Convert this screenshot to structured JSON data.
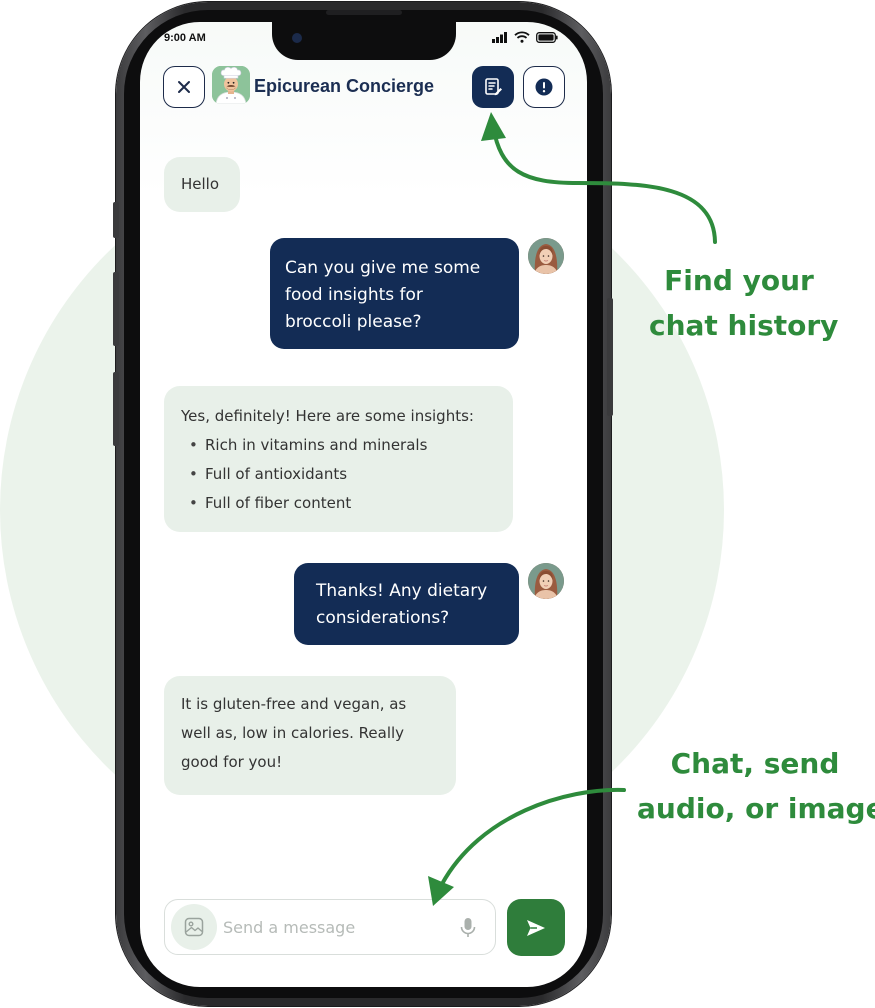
{
  "status_bar": {
    "time": "9:00 AM"
  },
  "header": {
    "title": "Epicurean Concierge",
    "close_icon": "close-icon",
    "history_icon": "chat-history-icon",
    "info_icon": "info-icon"
  },
  "messages": [
    {
      "sender": "bot",
      "text": "Hello"
    },
    {
      "sender": "user",
      "lines": [
        "Can you give me some",
        "food insights for",
        "broccoli please?"
      ]
    },
    {
      "sender": "bot",
      "intro": "Yes, definitely! Here are some insights:",
      "items": [
        "Rich in vitamins and minerals",
        "Full of antioxidants",
        "Full of fiber content"
      ]
    },
    {
      "sender": "user",
      "lines": [
        "Thanks! Any dietary",
        "considerations?"
      ]
    },
    {
      "sender": "bot",
      "lines": [
        "It is gluten-free and vegan, as",
        "well as, low in calories. Really",
        "good for you!"
      ]
    }
  ],
  "composer": {
    "placeholder": "Send a message",
    "value": "",
    "image_icon": "image-icon",
    "mic_icon": "microphone-icon",
    "send_icon": "send-icon"
  },
  "annotations": {
    "history": [
      "Find your",
      "chat history"
    ],
    "composer": [
      "Chat, send",
      "audio, or image"
    ]
  },
  "colors": {
    "navy": "#132c55",
    "accent_green": "#2e8b3c",
    "bot_bubble": "#e8f0e9",
    "background_circle": "#ebf3eb"
  }
}
